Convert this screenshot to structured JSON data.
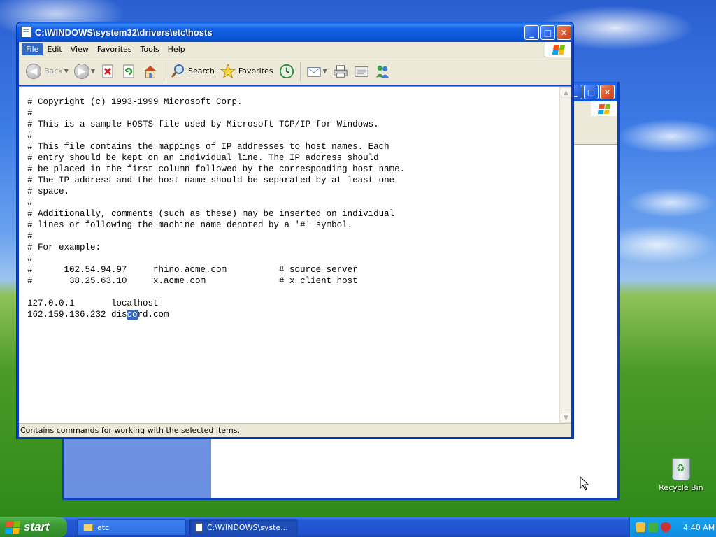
{
  "window": {
    "title": "C:\\WINDOWS\\system32\\drivers\\etc\\hosts",
    "menu": [
      "File",
      "Edit",
      "View",
      "Favorites",
      "Tools",
      "Help"
    ],
    "toolbar": {
      "back_label": "Back",
      "search_label": "Search",
      "favorites_label": "Favorites"
    },
    "content_lines": [
      "# Copyright (c) 1993-1999 Microsoft Corp.",
      "#",
      "# This is a sample HOSTS file used by Microsoft TCP/IP for Windows.",
      "#",
      "# This file contains the mappings of IP addresses to host names. Each",
      "# entry should be kept on an individual line. The IP address should",
      "# be placed in the first column followed by the corresponding host name.",
      "# The IP address and the host name should be separated by at least one",
      "# space.",
      "#",
      "# Additionally, comments (such as these) may be inserted on individual",
      "# lines or following the machine name denoted by a '#' symbol.",
      "#",
      "# For example:",
      "#",
      "#      102.54.94.97     rhino.acme.com          # source server",
      "#       38.25.63.10     x.acme.com              # x client host",
      "",
      "127.0.0.1       localhost"
    ],
    "last_line": {
      "before": "162.159.136.232 dis",
      "selected": "co",
      "after": "rd.com"
    },
    "status_text": "Contains commands for working with the selected items."
  },
  "taskbar": {
    "start_label": "start",
    "tasks": [
      "etc",
      "C:\\WINDOWS\\syste..."
    ],
    "clock": "4:40 AM"
  },
  "desktop": {
    "recycle_bin_label": "Recycle Bin"
  },
  "colors": {
    "title_blue": "#0a5ee8",
    "selection": "#316ac5",
    "start_green": "#3c9a35"
  }
}
